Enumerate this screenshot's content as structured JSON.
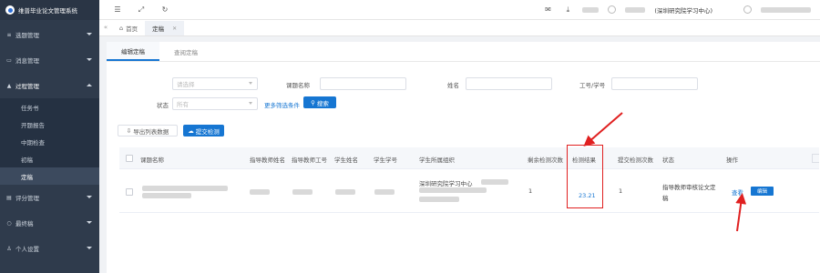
{
  "app": {
    "title": "维普毕业论文管理系统"
  },
  "sidebar": {
    "items": [
      {
        "label": "选题管理",
        "icon": "list-icon"
      },
      {
        "label": "消息管理",
        "icon": "message-icon"
      },
      {
        "label": "过程管理",
        "icon": "process-icon",
        "open": true,
        "children": [
          {
            "label": "任务书"
          },
          {
            "label": "开题报告"
          },
          {
            "label": "中期检查"
          },
          {
            "label": "初稿"
          },
          {
            "label": "定稿",
            "active": true
          }
        ]
      },
      {
        "label": "评分管理",
        "icon": "score-icon"
      },
      {
        "label": "最终稿",
        "icon": "final-icon"
      },
      {
        "label": "个人设置",
        "icon": "user-icon"
      }
    ]
  },
  "topbar": {
    "org_label": "(深圳研究院学习中心)"
  },
  "tabstrip": {
    "home_label": "首页",
    "active_tab": "定稿"
  },
  "content": {
    "subtabs": [
      "编辑定稿",
      "查阅定稿"
    ],
    "filters": {
      "group_label": "组织",
      "group_placeholder": "请选择",
      "topic_label": "课题名称",
      "name_label": "姓名",
      "id_label": "工号/学号",
      "status_label": "状态",
      "status_value": "所有",
      "more_filters": "更多筛选条件",
      "search_button": "搜索"
    },
    "actions": {
      "export_button": "导出列表数据",
      "submit_check_button": "提交检测"
    },
    "table": {
      "headers": [
        "课题名称",
        "指导教师姓名",
        "指导教师工号",
        "学生姓名",
        "学生学号",
        "学生所属组织",
        "剩余检测次数",
        "检测结果",
        "提交检测次数",
        "状态",
        "操作"
      ],
      "rows": [
        {
          "org": "深圳研究院学习中心",
          "remaining": "1",
          "result": "23.21",
          "submitted": "1",
          "status_line1": "指导教师审核论文定",
          "status_line2": "稿",
          "view_label": "查看",
          "edit_label": "编辑"
        }
      ]
    }
  },
  "colors": {
    "accent": "#1676d2",
    "sidebar": "#2f3b4c",
    "annotation": "#e02020"
  }
}
